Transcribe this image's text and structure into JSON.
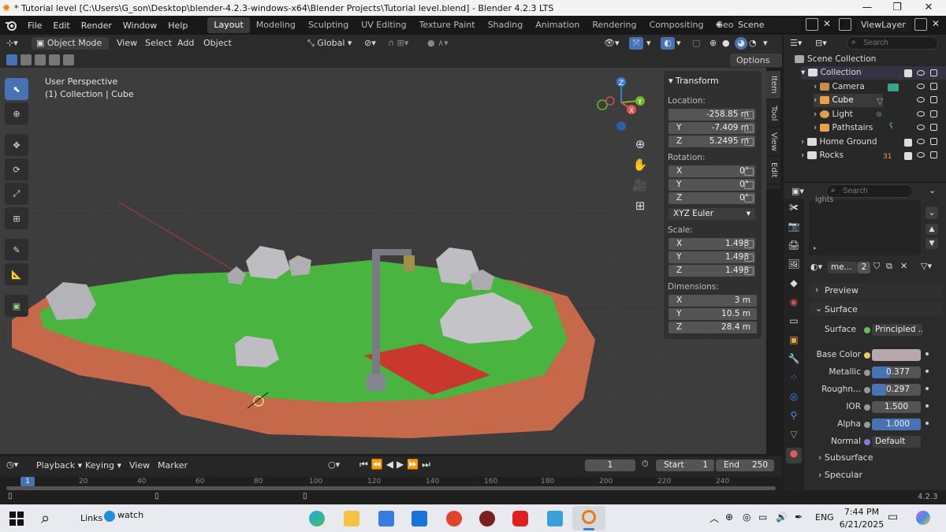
{
  "window": {
    "title": "* Tutorial level [C:\\Users\\G_son\\Desktop\\blender-4.2.3-windows-x64\\Blender Projects\\Tutorial level.blend] - Blender 4.2.3 LTS",
    "minimize": "—",
    "maximize": "❐",
    "close": "✕"
  },
  "menubar": {
    "menus": [
      "File",
      "Edit",
      "Render",
      "Window",
      "Help"
    ],
    "workspaces": [
      "Layout",
      "Modeling",
      "Sculpting",
      "UV Editing",
      "Texture Paint",
      "Shading",
      "Animation",
      "Rendering",
      "Compositing",
      "Geometry Node"
    ],
    "active_workspace": "Layout",
    "scene": "Scene",
    "view_layer": "ViewLayer"
  },
  "viewport_header": {
    "mode": "Object Mode",
    "menus": [
      "View",
      "Select",
      "Add",
      "Object"
    ],
    "transform_orientation": "Global",
    "options": "Options"
  },
  "viewport": {
    "perspective": "User Perspective",
    "context": "(1) Collection | Cube",
    "gizmo": {
      "z": "Z",
      "y": "Y",
      "x": "X"
    }
  },
  "npanel": {
    "title": "Transform",
    "location_label": "Location:",
    "location": [
      {
        "axis": "",
        "value": "-258.85 m"
      },
      {
        "axis": "Y",
        "value": "-7.409 m"
      },
      {
        "axis": "Z",
        "value": "5.2495 m"
      }
    ],
    "rotation_label": "Rotation:",
    "rotation": [
      {
        "axis": "X",
        "value": "0°"
      },
      {
        "axis": "Y",
        "value": "0°"
      },
      {
        "axis": "Z",
        "value": "0°"
      }
    ],
    "rotation_mode": "XYZ Euler",
    "scale_label": "Scale:",
    "scale": [
      {
        "axis": "X",
        "value": "1.498"
      },
      {
        "axis": "Y",
        "value": "1.498"
      },
      {
        "axis": "Z",
        "value": "1.498"
      }
    ],
    "dimensions_label": "Dimensions:",
    "dimensions": [
      {
        "axis": "X",
        "value": "3 m"
      },
      {
        "axis": "Y",
        "value": "10.5 m"
      },
      {
        "axis": "Z",
        "value": "28.4 m"
      }
    ]
  },
  "sidetabs": [
    "Item",
    "Tool",
    "View",
    "Edit"
  ],
  "outliner": {
    "search_placeholder": "Search",
    "root": "Scene Collection",
    "items": [
      {
        "name": "Collection",
        "level": 1
      },
      {
        "name": "Camera",
        "level": 2
      },
      {
        "name": "Cube",
        "level": 2
      },
      {
        "name": "Light",
        "level": 2
      },
      {
        "name": "Pathstairs",
        "level": 2
      },
      {
        "name": "Home Ground",
        "level": 1
      },
      {
        "name": "Rocks",
        "level": 1
      }
    ],
    "rocks_badge": "31"
  },
  "properties": {
    "search_placeholder": "Search",
    "material_slot_text": "ights",
    "material_name": "me...",
    "material_users": "2",
    "preview": "Preview",
    "surface": "Surface",
    "surface_label": "Surface",
    "surface_value": "Principled ...",
    "rows": [
      {
        "label": "Base Color",
        "value": ""
      },
      {
        "label": "Metallic",
        "value": "0.377",
        "fill": 0.377
      },
      {
        "label": "Roughn...",
        "value": "0.297",
        "fill": 0.297
      },
      {
        "label": "IOR",
        "value": "1.500",
        "fill": 0
      },
      {
        "label": "Alpha",
        "value": "1.000",
        "fill": 1.0
      }
    ],
    "normal_label": "Normal",
    "normal_value": "Default",
    "subsurface": "Subsurface",
    "specular": "Specular"
  },
  "timeline": {
    "menus": [
      "Playback",
      "Keying",
      "View",
      "Marker"
    ],
    "current_frame": "1",
    "start_label": "Start",
    "start": "1",
    "end_label": "End",
    "end": "250",
    "ticks": [
      "1",
      "20",
      "40",
      "60",
      "80",
      "100",
      "120",
      "140",
      "160",
      "180",
      "200",
      "220",
      "240"
    ]
  },
  "statusbar": {
    "version": "4.2.3"
  },
  "taskbar": {
    "links": "Links",
    "watch": "watch",
    "lang": "ENG",
    "time": "7:44 PM",
    "date": "6/21/2025"
  }
}
